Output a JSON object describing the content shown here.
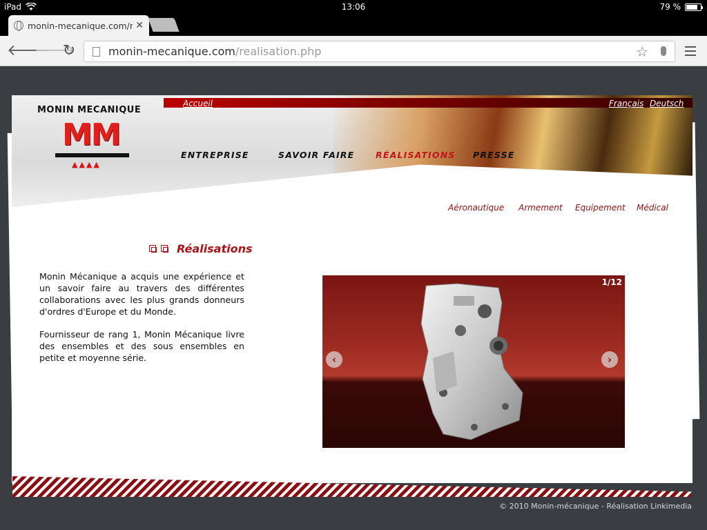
{
  "status_bar": {
    "device": "iPad",
    "time": "13:06",
    "battery": "79 %",
    "battery_level": 0.79
  },
  "browser": {
    "tab_title": "monin-mecanique.com/re",
    "url_host": "monin-mecanique.com",
    "url_path": "/realisation.php"
  },
  "site": {
    "brand": "MONIN MECANIQUE",
    "logo_text": "MM",
    "logo_marks": "▲▲▲▲",
    "nav_home": "Accueil",
    "languages": [
      "Français",
      "Deutsch"
    ],
    "main_nav": [
      "ENTREPRISE",
      "SAVOIR FAIRE",
      "RÉALISATIONS",
      "PRESSE"
    ],
    "sub_nav": [
      "Aéronautique",
      "Armement",
      "Equipement",
      "Médical"
    ],
    "section_title": "Réalisations",
    "paragraphs": [
      "Monin Mécanique a acquis une expérience et un savoir faire au travers des différentes collaborations avec les plus grands donneurs d'ordres d'Europe et du Monde.",
      "Fournisseur de rang 1, Monin Mécanique livre des ensembles et des sous ensembles en petite et moyenne série."
    ],
    "slideshow": {
      "counter": "1/12",
      "current": 1,
      "total": 12
    },
    "copyright": "© 2010 Monin-mécanique - Réalisation Linkimedia"
  },
  "colors": {
    "accent_red": "#a8141a",
    "page_bg": "#3a3d42"
  },
  "icons": {
    "wifi": "wifi-icon",
    "back": "back-arrow-icon",
    "forward": "forward-arrow-icon",
    "reload": "reload-icon",
    "bookmark": "star-icon",
    "voice": "microphone-icon",
    "menu": "hamburger-menu-icon"
  }
}
